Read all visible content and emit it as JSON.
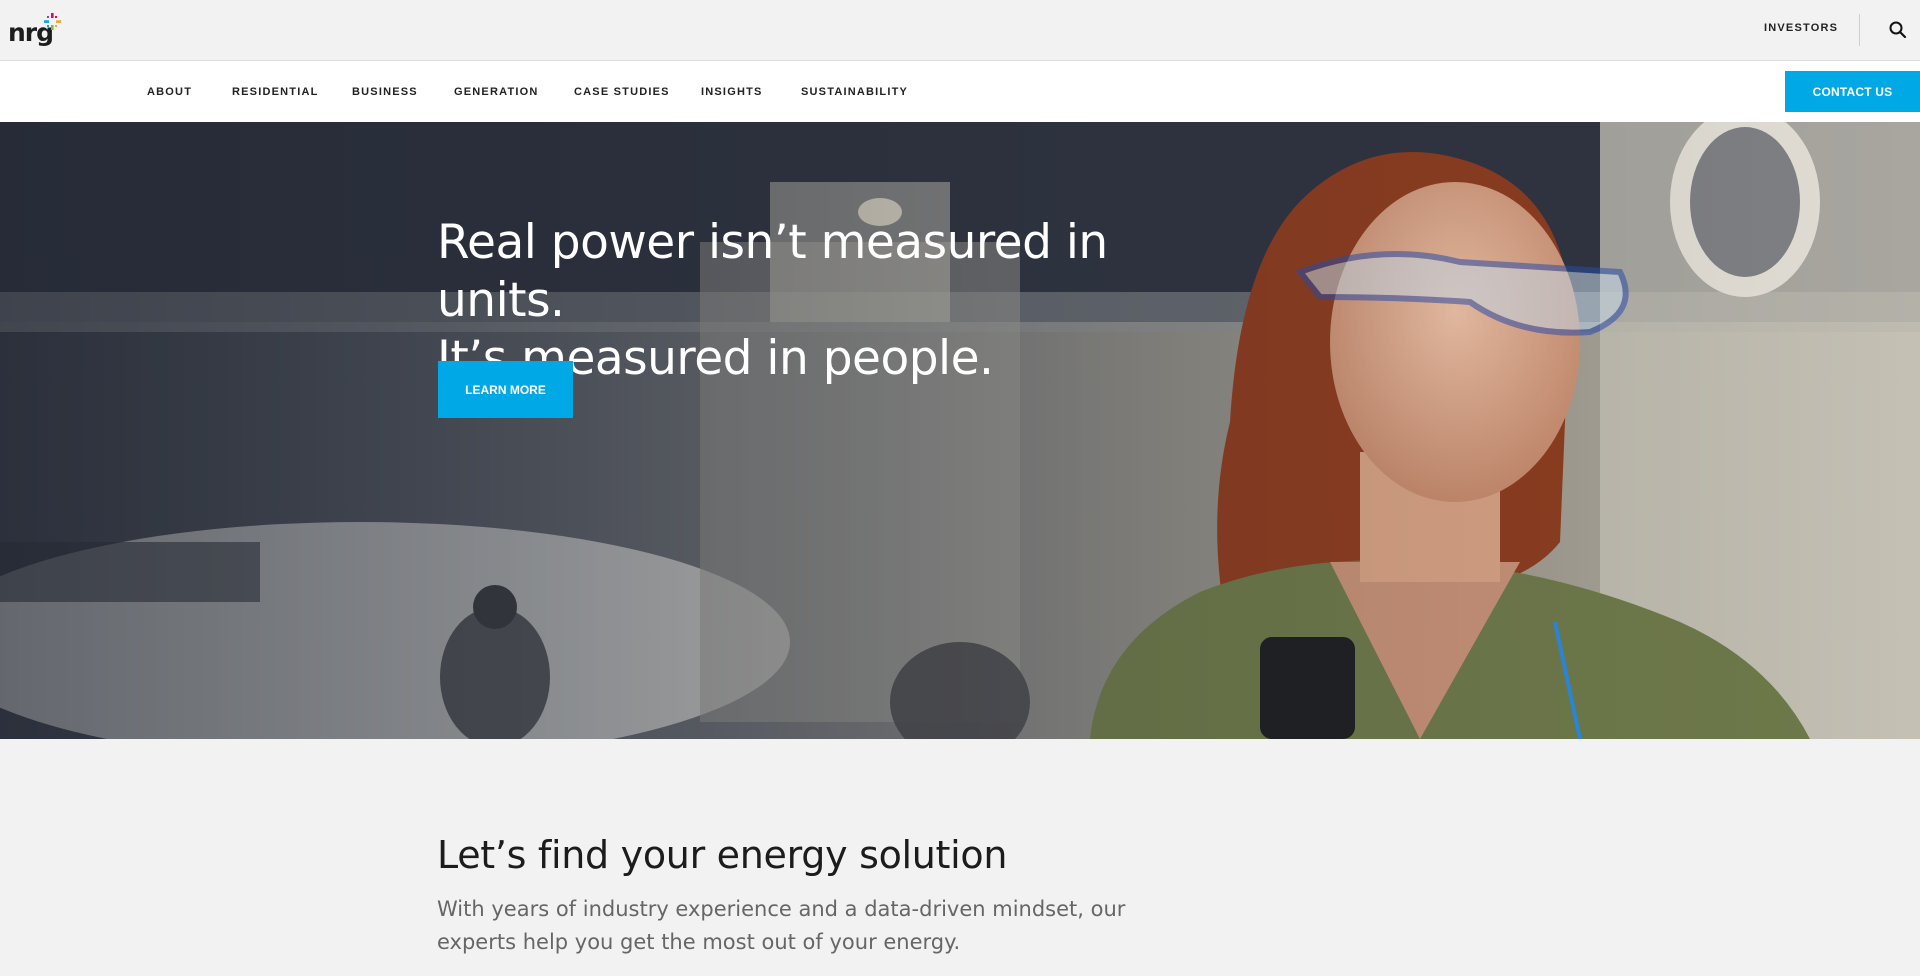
{
  "brand": {
    "logo_text": "nrg",
    "logo_accent_colors": [
      "#e4007c",
      "#00a8e6",
      "#f5a623",
      "#7ac143"
    ]
  },
  "utility": {
    "investors_label": "INVESTORS",
    "search_icon": "search-icon"
  },
  "nav": {
    "items": [
      {
        "label": "ABOUT"
      },
      {
        "label": "RESIDENTIAL"
      },
      {
        "label": "BUSINESS"
      },
      {
        "label": "GENERATION"
      },
      {
        "label": "CASE STUDIES"
      },
      {
        "label": "INSIGHTS"
      },
      {
        "label": "SUSTAINABILITY"
      }
    ],
    "contact_label": "CONTACT US"
  },
  "hero": {
    "headline_line1": "Real power isn’t measured in units.",
    "headline_line2": "It’s measured in people.",
    "cta_label": "LEARN MORE"
  },
  "solution": {
    "title": "Let’s find your energy solution",
    "body": "With years of industry experience and a data-driven mindset, our experts help you get the most out of your energy."
  },
  "colors": {
    "accent": "#00a8e6",
    "nav_bg": "#ffffff",
    "page_bg": "#f2f2f2"
  }
}
